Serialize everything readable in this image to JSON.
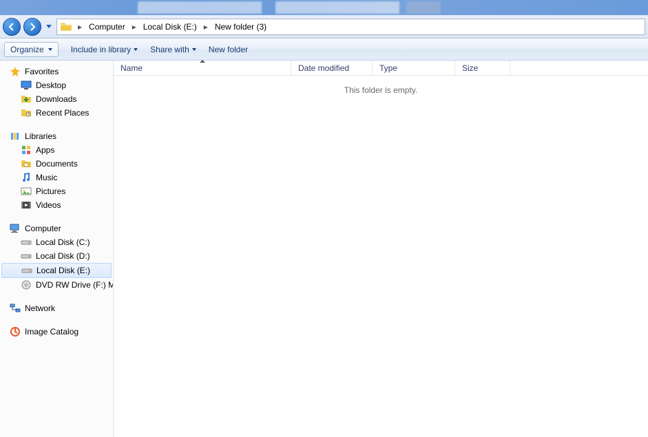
{
  "breadcrumb": {
    "items": [
      "Computer",
      "Local Disk (E:)",
      "New folder (3)"
    ]
  },
  "toolbar": {
    "organize": "Organize",
    "include": "Include in library",
    "share": "Share with",
    "newfolder": "New folder"
  },
  "columns": {
    "name": "Name",
    "date": "Date modified",
    "type": "Type",
    "size": "Size"
  },
  "empty_text": "This folder is empty.",
  "sidebar": {
    "favorites": {
      "label": "Favorites",
      "items": [
        "Desktop",
        "Downloads",
        "Recent Places"
      ]
    },
    "libraries": {
      "label": "Libraries",
      "items": [
        "Apps",
        "Documents",
        "Music",
        "Pictures",
        "Videos"
      ]
    },
    "computer": {
      "label": "Computer",
      "items": [
        "Local Disk (C:)",
        "Local Disk (D:)",
        "Local Disk (E:)",
        "DVD RW Drive (F:)  M"
      ]
    },
    "network": {
      "label": "Network"
    },
    "imgcat": {
      "label": "Image Catalog"
    }
  }
}
